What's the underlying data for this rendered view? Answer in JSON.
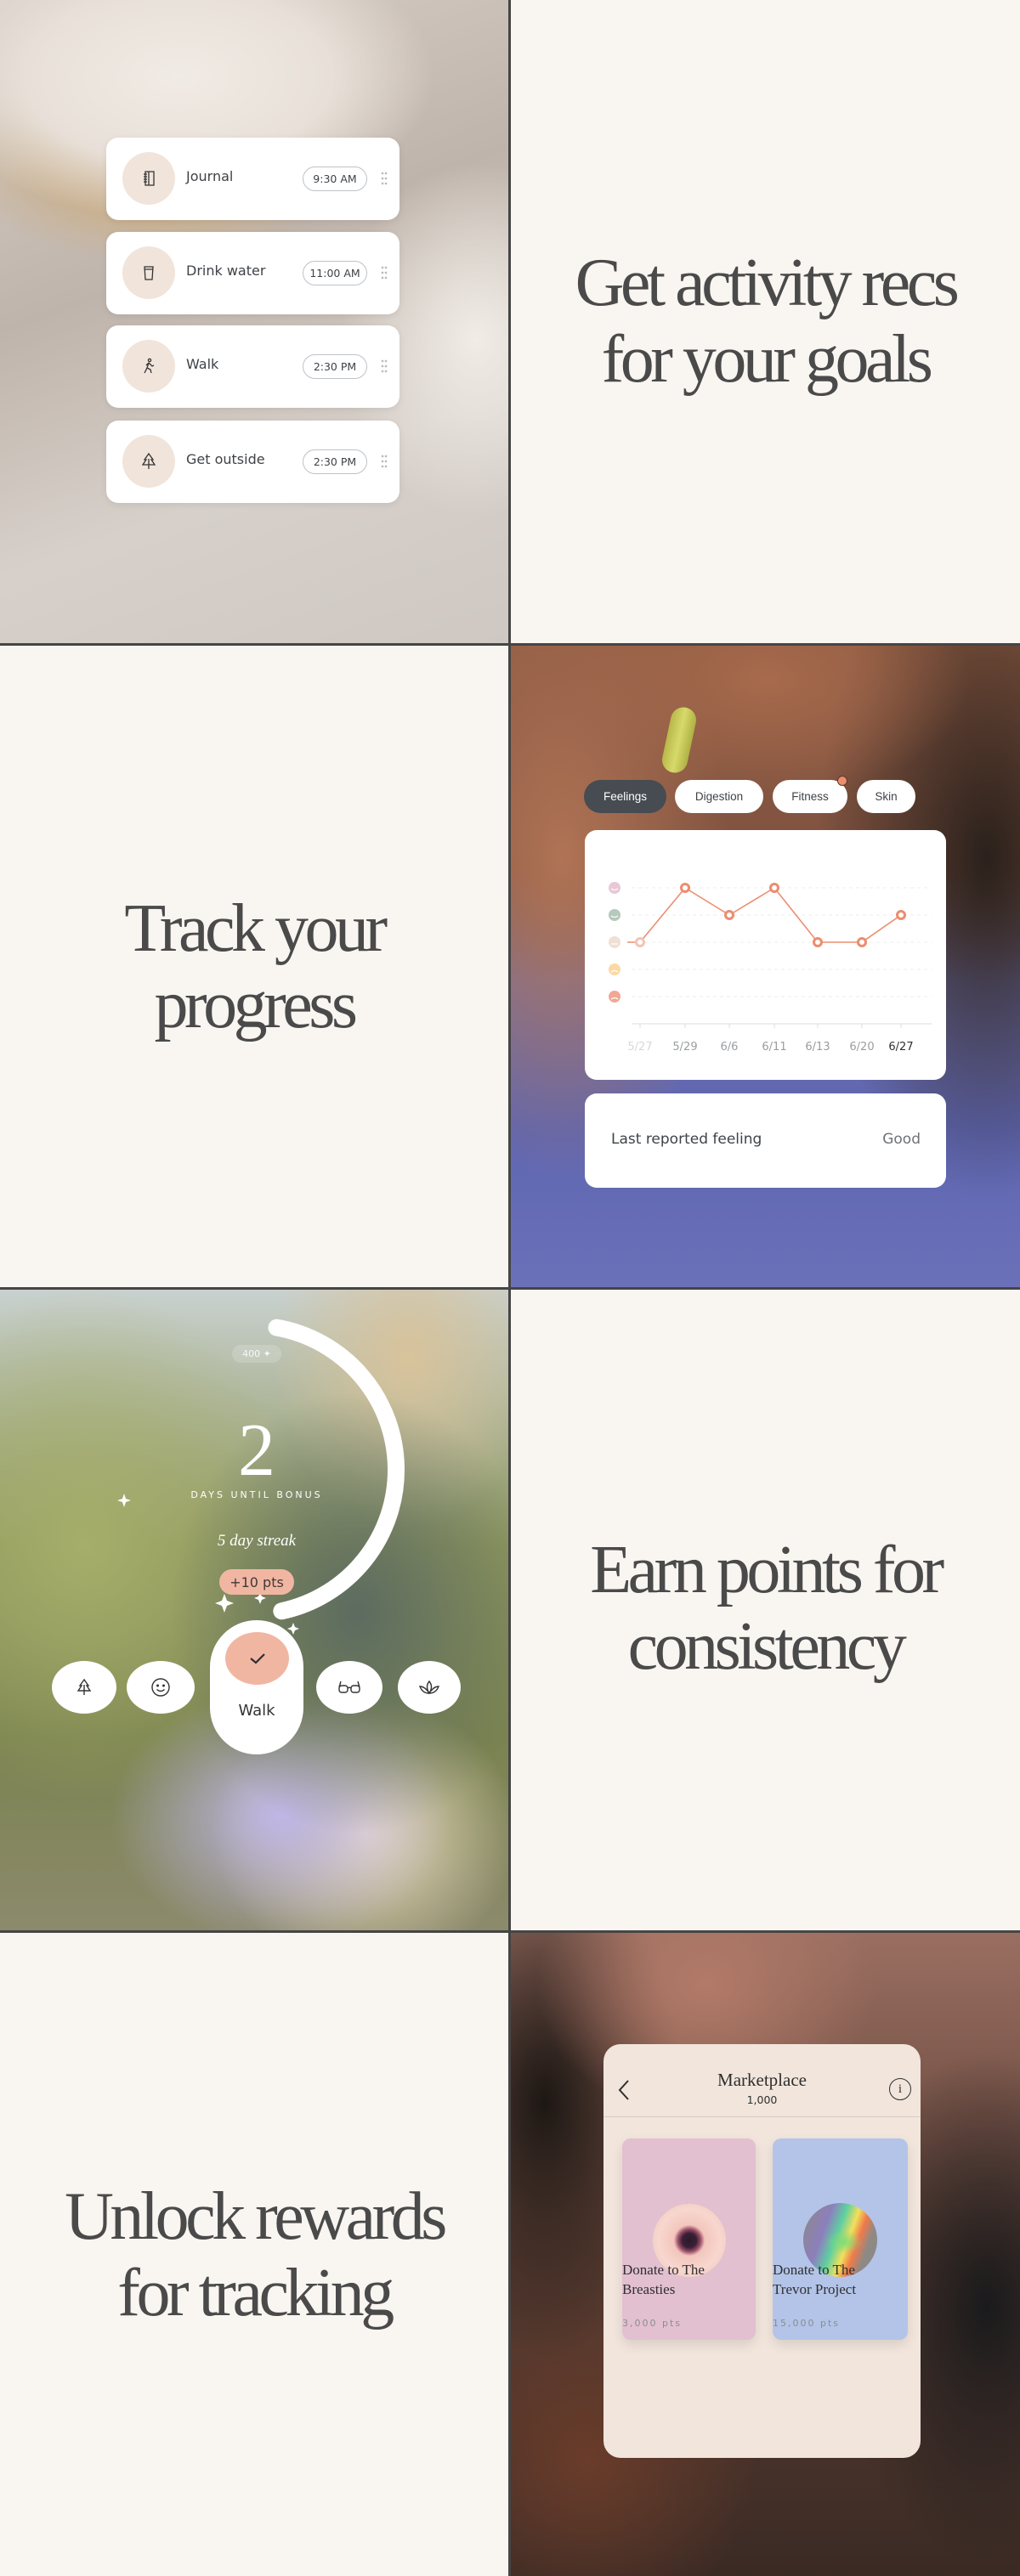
{
  "panels": {
    "tasks": {
      "items": [
        {
          "label": "Journal",
          "time": "9:30 AM",
          "icon": "journal-icon"
        },
        {
          "label": "Drink water",
          "time": "11:00 AM",
          "icon": "cup-icon"
        },
        {
          "label": "Walk",
          "time": "2:30 PM",
          "icon": "walk-icon"
        },
        {
          "label": "Get outside",
          "time": "2:30 PM",
          "icon": "tree-icon"
        }
      ]
    },
    "headline_1": [
      "Get activity recs",
      "for your goals"
    ],
    "headline_2": [
      "Track your",
      "progress"
    ],
    "headline_3": [
      "Earn points for",
      "consistency"
    ],
    "headline_4": [
      "Unlock rewards",
      "for tracking"
    ],
    "tracker": {
      "tabs": [
        {
          "label": "Feelings",
          "active": true
        },
        {
          "label": "Digestion",
          "active": false
        },
        {
          "label": "Fitness",
          "active": false,
          "badge": true
        },
        {
          "label": "Skin",
          "active": false
        }
      ],
      "last_reported_label": "Last reported feeling",
      "last_reported_value": "Good"
    },
    "streak": {
      "points_total": "400 ✦",
      "days": "2",
      "days_label": "DAYS UNTIL BONUS",
      "streak_text": "5 day streak",
      "bonus": "+10 pts",
      "bonus_progress": 0.6,
      "active_activity": "Walk",
      "activities": [
        "tree-icon",
        "smile-icon",
        "walk-check",
        "glasses-icon",
        "lotus-icon"
      ]
    },
    "marketplace": {
      "title": "Marketplace",
      "balance": "1,000",
      "rewards": [
        {
          "title_line1": "Donate to The",
          "title_line2": "Breasties",
          "points": "3,000 pts",
          "color": "#e2c0d0"
        },
        {
          "title_line1": "Donate to The",
          "title_line2": "Trevor Project",
          "points": "15,000 pts",
          "color": "#b3c4e8"
        }
      ]
    }
  },
  "colors": {
    "accent": "#ec8d6f",
    "panel_bg": "#f9f5f1",
    "bonus_pill": "#f1b6a2",
    "icon_circle": "#f1e4da",
    "tab_active": "#464c51"
  },
  "chart_data": {
    "type": "line",
    "categories": [
      "5/27",
      "5/29",
      "6/6",
      "6/11",
      "6/13",
      "6/20",
      "6/27"
    ],
    "values": [
      3,
      5,
      4,
      5,
      3,
      3,
      4
    ],
    "y_levels": [
      "very-bad",
      "bad",
      "neutral",
      "good",
      "great"
    ],
    "ylim": [
      1,
      5
    ],
    "grid": true,
    "highlighted_category": "6/27",
    "level_colors": [
      "#f2a894",
      "#fbd9a4",
      "#efe0d6",
      "#b5c9bd",
      "#e8c8d6"
    ],
    "line_color": "#ec8d6f"
  }
}
